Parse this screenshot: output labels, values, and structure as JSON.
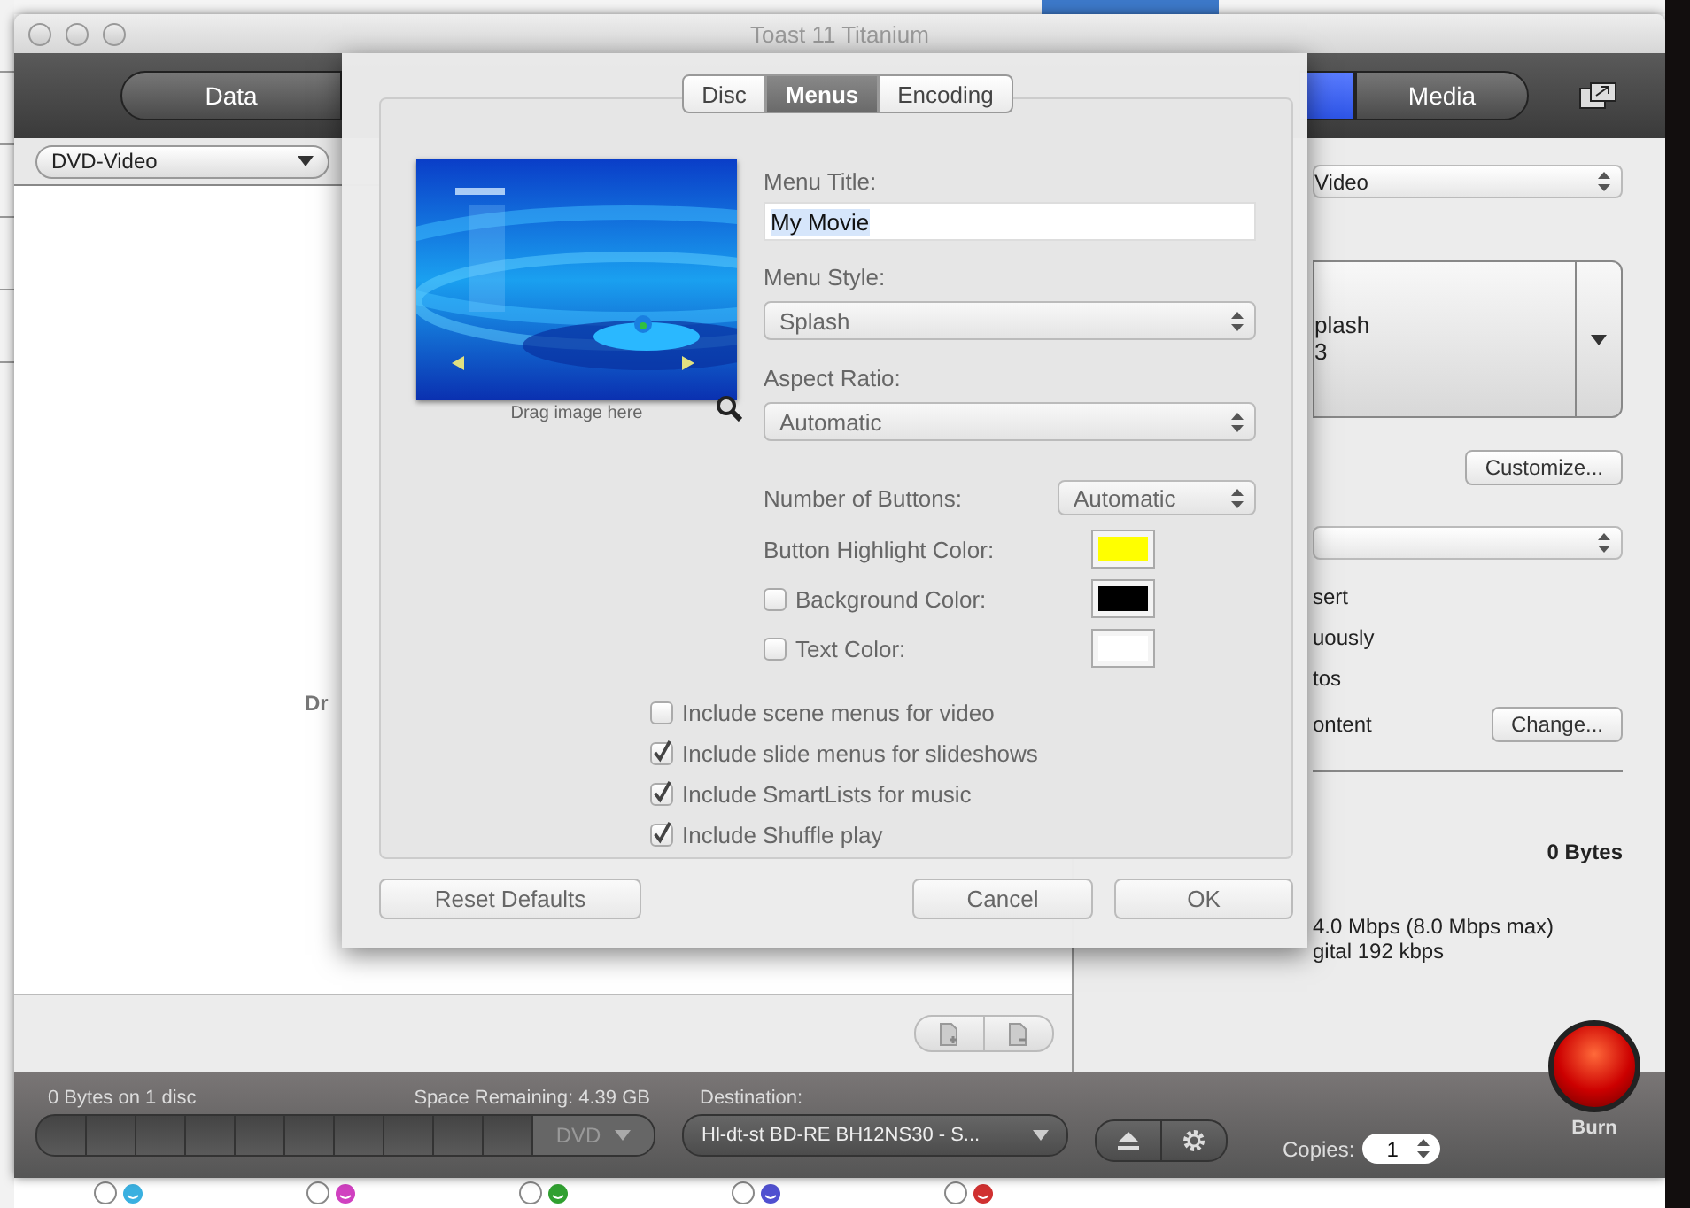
{
  "window": {
    "title": "Toast 11 Titanium"
  },
  "toolbar": {
    "segments": [
      {
        "label": "Data",
        "selected": false
      },
      {
        "selected": true
      },
      {
        "label": "Media",
        "selected": false
      }
    ]
  },
  "source": {
    "format": "DVD-Video",
    "drop_hint": "Dr"
  },
  "settings": {
    "format": "Video",
    "menu_style": {
      "name": "plash",
      "aspect": "3"
    },
    "customize": "Customize...",
    "options": [
      "sert",
      "uously",
      "tos",
      "ontent"
    ],
    "change": "Change...",
    "total": "0 Bytes",
    "video": "4.0 Mbps (8.0 Mbps max)",
    "audio": "gital 192 kbps"
  },
  "dialog": {
    "tabs": [
      {
        "label": "Disc",
        "selected": false
      },
      {
        "label": "Menus",
        "selected": true
      },
      {
        "label": "Encoding",
        "selected": false
      }
    ],
    "thumbnail_caption": "Drag image here",
    "menu_title": {
      "label": "Menu Title:",
      "value": "My Movie"
    },
    "menu_style": {
      "label": "Menu Style:",
      "value": "Splash"
    },
    "aspect_ratio": {
      "label": "Aspect Ratio:",
      "value": "Automatic"
    },
    "button_count": {
      "label": "Number of Buttons:",
      "value": "Automatic"
    },
    "colors": [
      {
        "label": "Button Highlight Color:",
        "color": "#ffff00"
      },
      {
        "label": "Background Color:",
        "checked": false,
        "color": "#000000"
      },
      {
        "label": "Text Color:",
        "checked": false,
        "color": "#ffffff"
      }
    ],
    "includes": [
      {
        "label": "Include scene menus for video",
        "checked": false
      },
      {
        "label": "Include slide menus for slideshows",
        "checked": true
      },
      {
        "label": "Include SmartLists for music",
        "checked": true
      },
      {
        "label": "Include Shuffle play",
        "checked": true
      }
    ],
    "buttons": [
      "Reset Defaults",
      "Cancel",
      "OK"
    ]
  },
  "ratings": [
    {
      "selected": false,
      "color": "#3ab0e0"
    },
    {
      "selected": false,
      "color": "#d040c0"
    },
    {
      "selected": false,
      "color": "#30a030"
    },
    {
      "selected": false,
      "color": "#5050d0"
    },
    {
      "selected": false,
      "color": "#d03030"
    }
  ],
  "status": {
    "used": "0 Bytes on 1 disc",
    "remaining": "Space Remaining: 4.39 GB",
    "media": "DVD",
    "destination_label": "Destination:",
    "destination": "Hl-dt-st BD-RE  BH12NS30 - S...",
    "copies_label": "Copies:",
    "copies": "1",
    "burn": "Burn"
  }
}
